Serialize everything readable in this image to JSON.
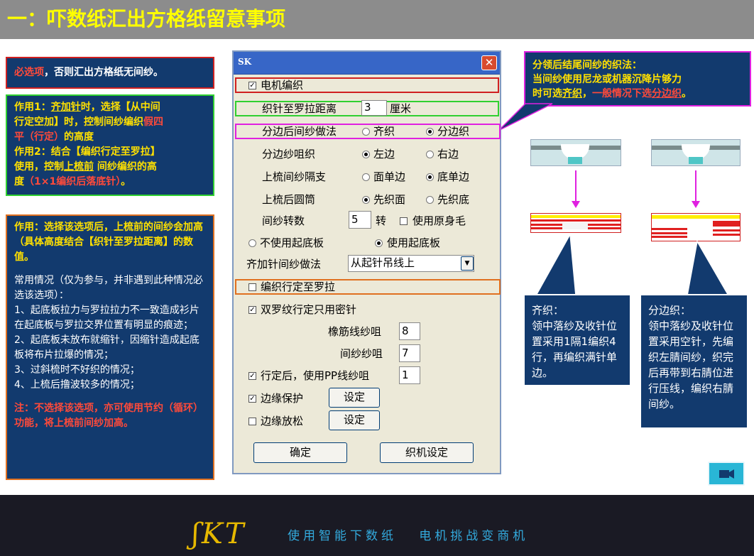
{
  "header": {
    "title": "一：吓数纸汇出方格纸留意事项"
  },
  "footer": {
    "logo": "ʃKT",
    "slogan": "使用智能下数纸   电机挑战变商机"
  },
  "notes": {
    "n1": {
      "a": "必选项",
      "b": "，否则汇出方格纸无间纱。"
    },
    "n2": {
      "l1a": "作用1：",
      "l1b": "齐加针",
      "l1c": "时，选择【从中间",
      "l2a": "行定空加】时，控制间纱编织",
      "l2b": "假四",
      "l3a": "平（行定）",
      "l3b": "的高度",
      "l4": "作用2：结合【编织行定至罗拉】",
      "l5a": "使用，控制",
      "l5b": "上梳前",
      "l5c": " 间纱编织的高",
      "l6a": "度",
      "l6b": "（1×1编织后落底针）",
      "l6c": "。"
    },
    "n3": {
      "p1": "作用：选择该选项后，上梳前的间纱会加高（具体高度结合【织针至罗拉距离】的数值。",
      "p2": "常用情况（仅为参与，并非遇到此种情况必选该选项）：",
      "i1": "1、起底板拉力与罗拉拉力不一致造成衫片在起底板与罗拉交界位置有明显的痕迹；",
      "i2": "2、起底板未放布就缩针，因缩针造成起底板将布片拉爆的情况；",
      "i3": "3、过斜梳时不好织的情况；",
      "i4": "4、上梳后撸波较多的情况；",
      "p3": "注：不选择该选项，亦可使用节约（循环）功能，将上梳前间纱加高。"
    },
    "n4": {
      "l1": "分领后结尾间纱的织法：",
      "l2": "当间纱使用尼龙或机器沉降片够力",
      "l3a": "时可选",
      "l3b": "齐织",
      "l3c": "，",
      "l3d": "一般情况下选",
      "l3e": "分边织",
      "l3f": "。"
    },
    "n5": {
      "title": "齐织：",
      "body": "领中落纱及收针位置采用1隔1编织4行，再编织满针单边。"
    },
    "n6": {
      "title": "分边织：",
      "body": "领中落纱及收针位置采用空针，先编织左腈间纱，织完后再带到右腈位进行压线，编织右腈间纱。"
    }
  },
  "dialog": {
    "title": "SK",
    "close": "✕",
    "motor": "电机编织",
    "distance_label": "织针至罗拉距离",
    "distance_value": "3",
    "distance_unit": "厘米",
    "split_method_label": "分边后间纱做法",
    "split_opt1": "齐织",
    "split_opt2": "分边织",
    "split_yarn_label": "分边纱咀织",
    "left": "左边",
    "right": "右边",
    "comb_gap_label": "上梳间纱隔支",
    "face_single": "面单边",
    "bottom_single": "底单边",
    "round_label": "上梳后圆筒",
    "first_face": "先织面",
    "first_bottom": "先织底",
    "turns_label": "间纱转数",
    "turns_value": "5",
    "turns_unit": "转",
    "use_own_wool": "使用原身毛",
    "no_board": "不使用起底板",
    "use_board": "使用起底板",
    "inc_label": "齐加针间纱做法",
    "inc_value": "从起针吊线上",
    "knit_to_roller": "编织行定至罗拉",
    "double_rib": "双罗纹行定只用密针",
    "rubber_label": "橡筋线纱咀",
    "rubber_value": "8",
    "gap_yarn_label": "间纱纱咀",
    "gap_yarn_value": "7",
    "after_pp": "行定后，使用PP线纱咀",
    "after_pp_value": "1",
    "edge_protect": "边缘保护",
    "edge_loose": "边缘放松",
    "settings": "设定",
    "ok": "确定",
    "machine_settings": "织机设定"
  },
  "colors": {
    "header_bg": "#8c8c8c",
    "note_bg": "#123a6e",
    "title_yellow": "#ffff00",
    "highlight_red": "#d02020",
    "highlight_green": "#30d030",
    "highlight_magenta": "#e020e0",
    "highlight_orange": "#e07020"
  },
  "icons": {
    "camera": "video-camera-icon"
  }
}
